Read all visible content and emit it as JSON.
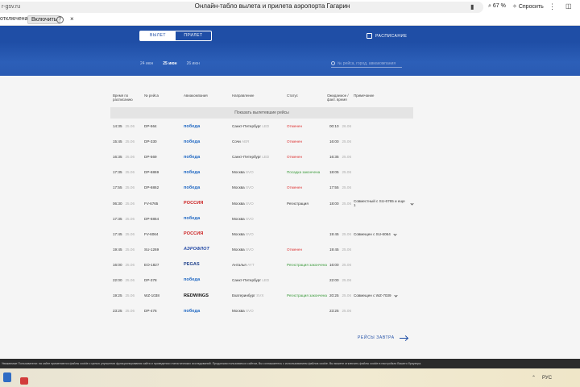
{
  "browser": {
    "address": "r-gsv.ru",
    "title": "Онлайн-табло вылета и прилета аэропорта Гагарин",
    "zoom": "67 %",
    "ask_label": "Спросить",
    "ext_status": "отключена",
    "ext_enable": "Включить",
    "ext_help": "?",
    "ext_close": "×"
  },
  "board": {
    "tab_departure": "вылет",
    "tab_arrival": "прилет",
    "schedule_label": "расписание",
    "dates": [
      "24 июн",
      "25 июн",
      "26 июн"
    ],
    "active_date_index": 1,
    "search_placeholder": "№ рейса, город, авиакомпания",
    "columns": [
      "Время по расписанию",
      "№ рейса",
      "Авиакомпания",
      "Направление",
      "Статус",
      "Ожидаемое / факт. время",
      "Примечание"
    ],
    "show_previous": "Показать вылетевшие рейсы",
    "flights": [
      {
        "time": "14:35",
        "date": "25.06",
        "flight": "DP-564",
        "airline": "победа",
        "dest": "Санкт-Петербург",
        "dest_code": "LED",
        "status": "Отменен",
        "status_type": "cancelled",
        "actual": "00:10",
        "actual_date": "26.06",
        "note": ""
      },
      {
        "time": "15:45",
        "date": "25.06",
        "flight": "DP-330",
        "airline": "победа",
        "dest": "Сочи",
        "dest_code": "AER",
        "status": "Отменен",
        "status_type": "cancelled",
        "actual": "16:00",
        "actual_date": "25.06",
        "note": ""
      },
      {
        "time": "16:35",
        "date": "25.06",
        "flight": "DP-569",
        "airline": "победа",
        "dest": "Санкт-Петербург",
        "dest_code": "LED",
        "status": "Отменен",
        "status_type": "cancelled",
        "actual": "16:35",
        "actual_date": "25.06",
        "note": ""
      },
      {
        "time": "17:35",
        "date": "25.06",
        "flight": "DP-6869",
        "airline": "победа",
        "dest": "Москва",
        "dest_code": "SVO",
        "status": "Посадка закончена",
        "status_type": "done",
        "actual": "18:05",
        "actual_date": "25.06",
        "note": ""
      },
      {
        "time": "17:55",
        "date": "25.06",
        "flight": "DP-6862",
        "airline": "победа",
        "dest": "Москва",
        "dest_code": "SVO",
        "status": "Отменен",
        "status_type": "cancelled",
        "actual": "17:55",
        "actual_date": "25.06",
        "note": ""
      },
      {
        "time": "06:30",
        "date": "25.06",
        "flight": "FV-6765",
        "airline": "РОССИЯ",
        "dest": "Москва",
        "dest_code": "SVO",
        "status": "Регистрация",
        "status_type": "normal",
        "actual": "18:00",
        "actual_date": "25.06",
        "note": "Совместный с SU-6765 и еще 1"
      },
      {
        "time": "17:35",
        "date": "25.06",
        "flight": "DP-6864",
        "airline": "победа",
        "dest": "Москва",
        "dest_code": "SVO",
        "status": "",
        "status_type": "normal",
        "actual": "",
        "actual_date": "",
        "note": ""
      },
      {
        "time": "17:45",
        "date": "25.06",
        "flight": "FV-6064",
        "airline": "РОССИЯ",
        "dest": "Москва",
        "dest_code": "SVO",
        "status": "",
        "status_type": "normal",
        "actual": "19:45",
        "actual_date": "25.06",
        "note": "Совмещен с SU-6064"
      },
      {
        "time": "19:45",
        "date": "25.06",
        "flight": "SU-1269",
        "airline": "АЭРОФЛОТ",
        "dest": "Москва",
        "dest_code": "SVO",
        "status": "Отменен",
        "status_type": "cancelled",
        "actual": "19:45",
        "actual_date": "25.06",
        "note": ""
      },
      {
        "time": "16:00",
        "date": "25.06",
        "flight": "EO-1827",
        "airline": "PEGAS",
        "dest": "Анталья",
        "dest_code": "AYT",
        "status": "Регистрация закончена",
        "status_type": "done",
        "actual": "16:00",
        "actual_date": "25.06",
        "note": ""
      },
      {
        "time": "22:00",
        "date": "25.06",
        "flight": "DP-378",
        "airline": "победа",
        "dest": "Санкт-Петербург",
        "dest_code": "LED",
        "status": "",
        "status_type": "normal",
        "actual": "22:00",
        "actual_date": "25.06",
        "note": ""
      },
      {
        "time": "19:25",
        "date": "25.06",
        "flight": "WZ-1038",
        "airline": "REDWINGS",
        "dest": "Екатеринбург",
        "dest_code": "SVX",
        "status": "Регистрация закончена",
        "status_type": "done",
        "actual": "20:25",
        "actual_date": "25.06",
        "note": "Совмещен с WZ-7039"
      },
      {
        "time": "23:25",
        "date": "25.06",
        "flight": "DP-476",
        "airline": "победа",
        "dest": "Москва",
        "dest_code": "SVO",
        "status": "",
        "status_type": "normal",
        "actual": "23:25",
        "actual_date": "25.06",
        "note": ""
      }
    ],
    "tomorrow_label": "рейсы завтра"
  },
  "cookie_text": "Уважаемые Пользователи: на сайте применяются файлы cookie с целью улучшения функционирования сайта и проведения статистических исследований. Продолжая пользоваться сайтом, Вы соглашаетесь с использованием файлов cookie. Вы можете отключить файлы cookie в настройках Вашего браузера.",
  "taskbar": {
    "lang": "РУС"
  },
  "colors": {
    "brand_blue": "#1f4ea6",
    "cancelled": "#dd3333",
    "done": "#3a9a3a"
  }
}
